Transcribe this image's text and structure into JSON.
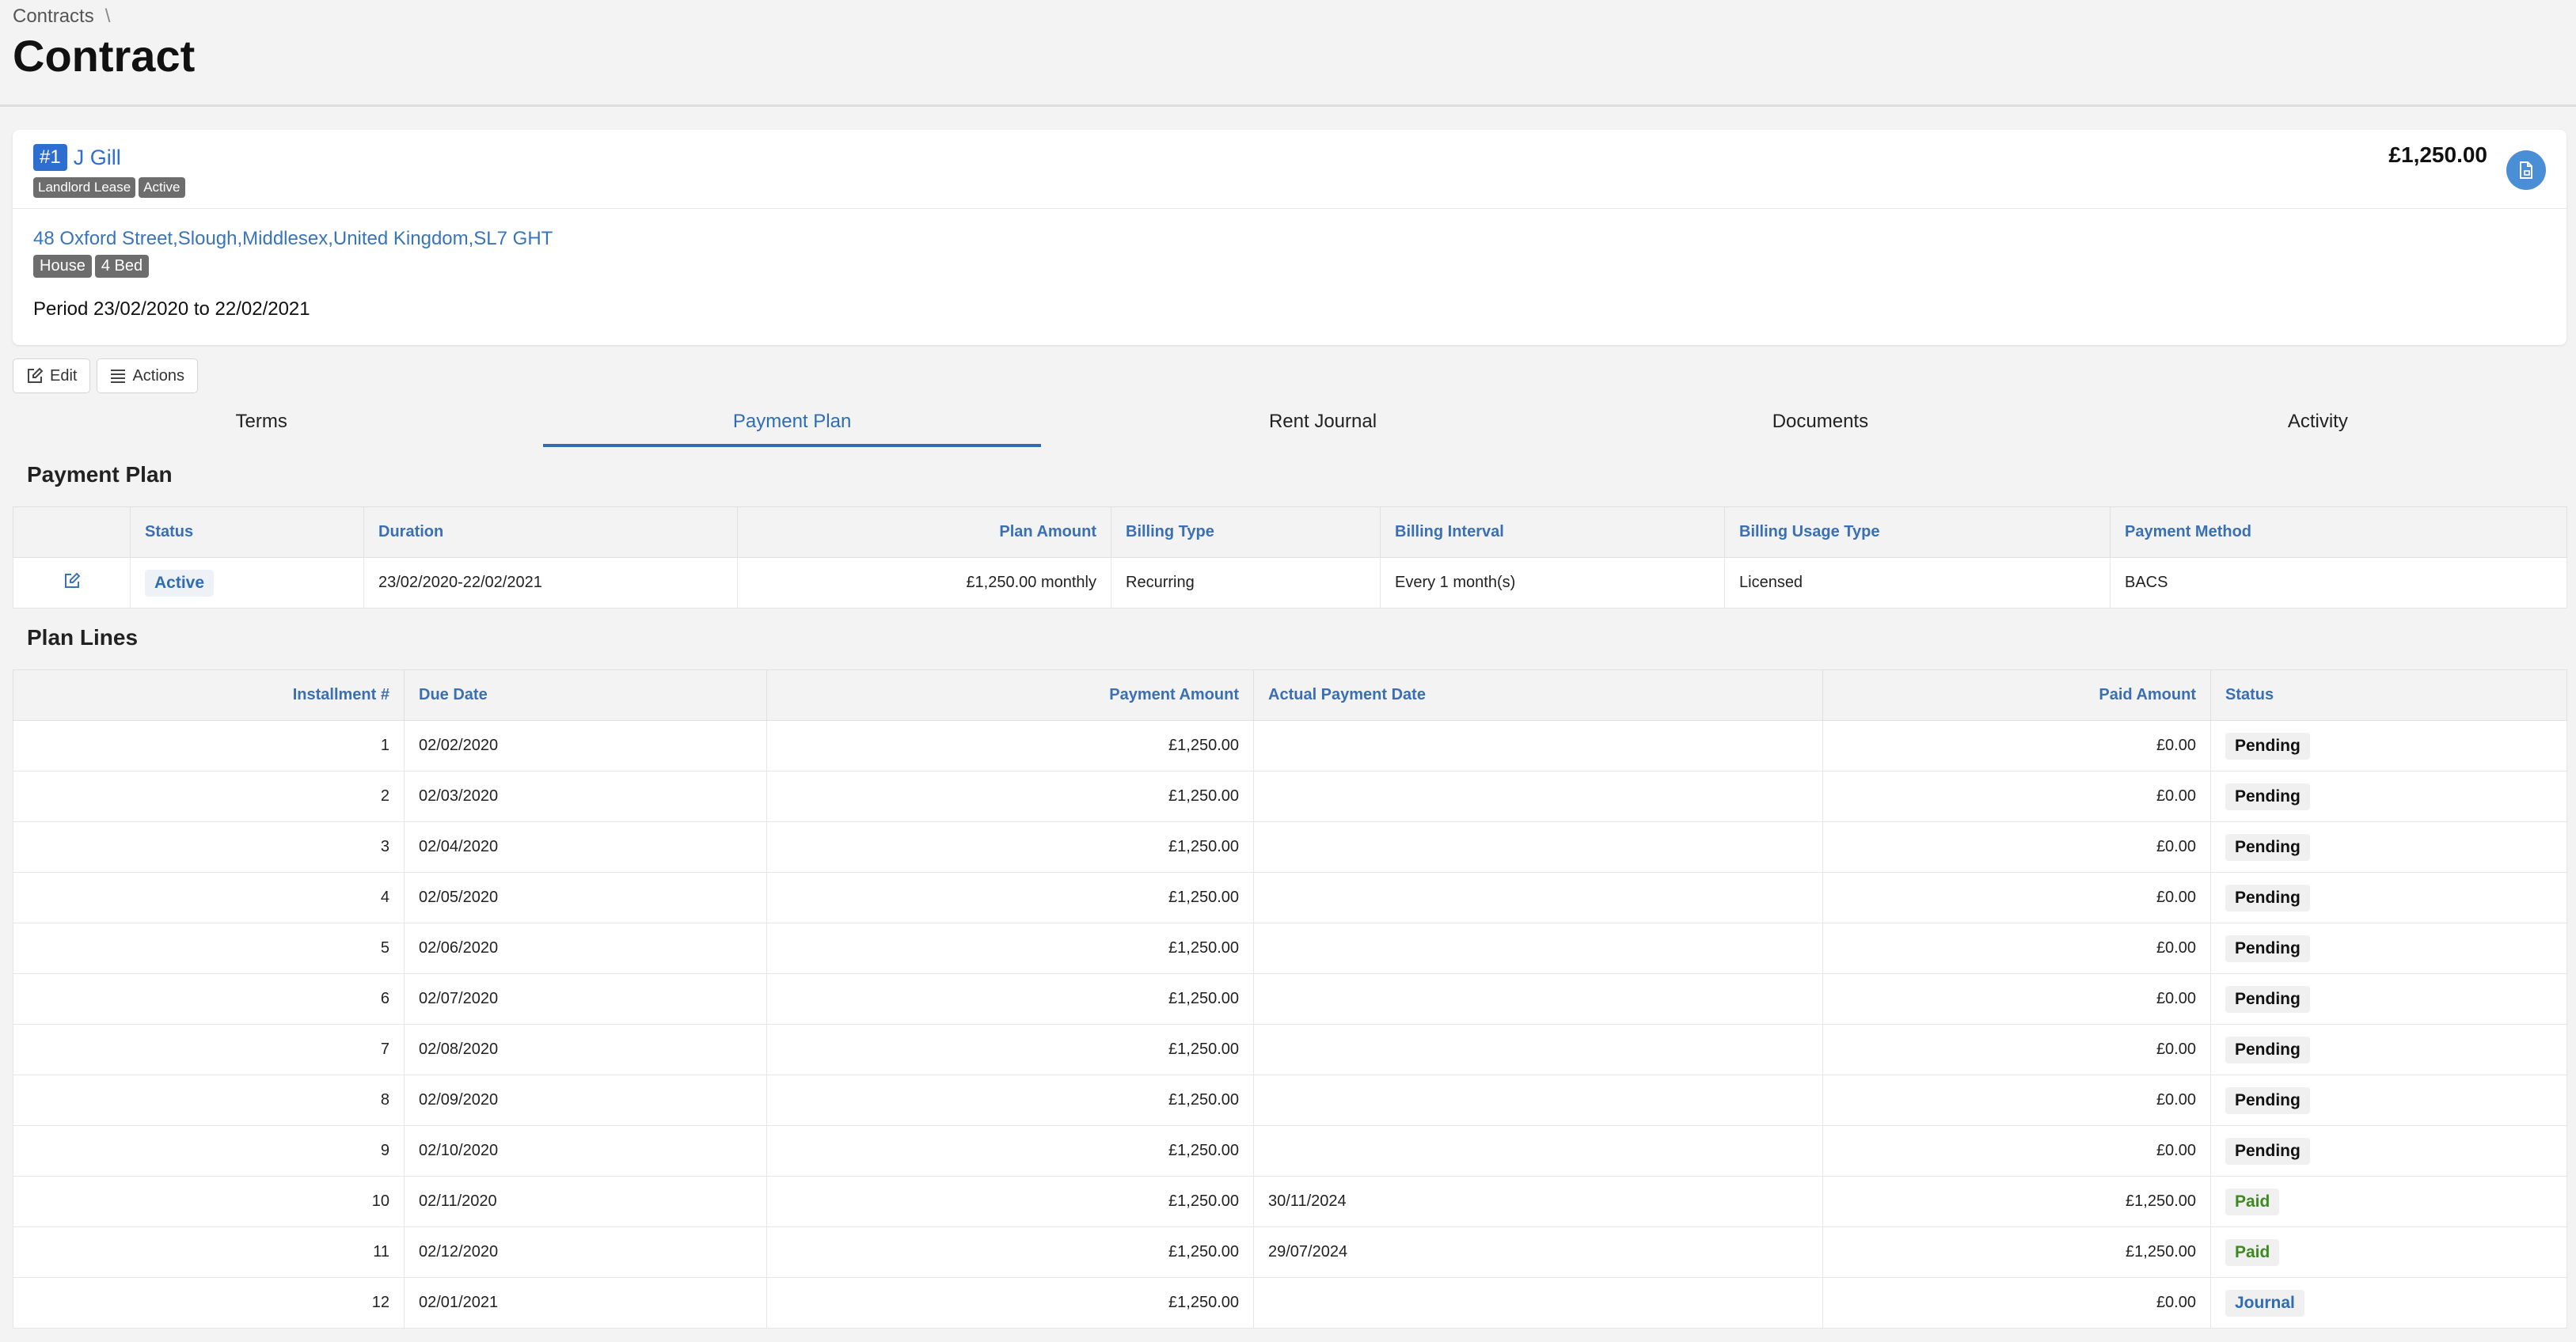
{
  "breadcrumb": {
    "parent": "Contracts",
    "separator": "\\"
  },
  "page_title": "Contract",
  "contract": {
    "id_badge": "#1",
    "name": "J Gill",
    "tags": [
      "Landlord Lease",
      "Active"
    ],
    "amount": "£1,250.00",
    "address": "48 Oxford Street,Slough,Middlesex,United Kingdom,SL7 GHT",
    "property_tags": [
      "House",
      "4 Bed"
    ],
    "period": "Period 23/02/2020 to 22/02/2021"
  },
  "toolbar": {
    "edit_label": "Edit",
    "actions_label": "Actions"
  },
  "tabs": [
    {
      "label": "Terms",
      "active": false
    },
    {
      "label": "Payment Plan",
      "active": true
    },
    {
      "label": "Rent Journal",
      "active": false
    },
    {
      "label": "Documents",
      "active": false
    },
    {
      "label": "Activity",
      "active": false
    }
  ],
  "payment_plan": {
    "title": "Payment Plan",
    "headers": {
      "status": "Status",
      "duration": "Duration",
      "plan_amount": "Plan Amount",
      "billing_type": "Billing Type",
      "billing_interval": "Billing Interval",
      "billing_usage_type": "Billing Usage Type",
      "payment_method": "Payment Method"
    },
    "row": {
      "status": "Active",
      "duration": "23/02/2020-22/02/2021",
      "plan_amount": "£1,250.00 monthly",
      "billing_type": "Recurring",
      "billing_interval": "Every 1 month(s)",
      "billing_usage_type": "Licensed",
      "payment_method": "BACS"
    }
  },
  "plan_lines": {
    "title": "Plan Lines",
    "headers": {
      "installment": "Installment #",
      "due_date": "Due Date",
      "payment_amount": "Payment Amount",
      "actual_payment_date": "Actual Payment Date",
      "paid_amount": "Paid Amount",
      "status": "Status"
    },
    "rows": [
      {
        "installment": "1",
        "due_date": "02/02/2020",
        "payment_amount": "£1,250.00",
        "actual_payment_date": "",
        "paid_amount": "£0.00",
        "status": "Pending"
      },
      {
        "installment": "2",
        "due_date": "02/03/2020",
        "payment_amount": "£1,250.00",
        "actual_payment_date": "",
        "paid_amount": "£0.00",
        "status": "Pending"
      },
      {
        "installment": "3",
        "due_date": "02/04/2020",
        "payment_amount": "£1,250.00",
        "actual_payment_date": "",
        "paid_amount": "£0.00",
        "status": "Pending"
      },
      {
        "installment": "4",
        "due_date": "02/05/2020",
        "payment_amount": "£1,250.00",
        "actual_payment_date": "",
        "paid_amount": "£0.00",
        "status": "Pending"
      },
      {
        "installment": "5",
        "due_date": "02/06/2020",
        "payment_amount": "£1,250.00",
        "actual_payment_date": "",
        "paid_amount": "£0.00",
        "status": "Pending"
      },
      {
        "installment": "6",
        "due_date": "02/07/2020",
        "payment_amount": "£1,250.00",
        "actual_payment_date": "",
        "paid_amount": "£0.00",
        "status": "Pending"
      },
      {
        "installment": "7",
        "due_date": "02/08/2020",
        "payment_amount": "£1,250.00",
        "actual_payment_date": "",
        "paid_amount": "£0.00",
        "status": "Pending"
      },
      {
        "installment": "8",
        "due_date": "02/09/2020",
        "payment_amount": "£1,250.00",
        "actual_payment_date": "",
        "paid_amount": "£0.00",
        "status": "Pending"
      },
      {
        "installment": "9",
        "due_date": "02/10/2020",
        "payment_amount": "£1,250.00",
        "actual_payment_date": "",
        "paid_amount": "£0.00",
        "status": "Pending"
      },
      {
        "installment": "10",
        "due_date": "02/11/2020",
        "payment_amount": "£1,250.00",
        "actual_payment_date": "30/11/2024",
        "paid_amount": "£1,250.00",
        "status": "Paid"
      },
      {
        "installment": "11",
        "due_date": "02/12/2020",
        "payment_amount": "£1,250.00",
        "actual_payment_date": "29/07/2024",
        "paid_amount": "£1,250.00",
        "status": "Paid"
      },
      {
        "installment": "12",
        "due_date": "02/01/2021",
        "payment_amount": "£1,250.00",
        "actual_payment_date": "",
        "paid_amount": "£0.00",
        "status": "Journal"
      }
    ]
  },
  "icons": {
    "document": "document-icon",
    "edit": "pencil-square-icon",
    "actions": "list-icon",
    "row_edit": "pencil-square-icon"
  },
  "colors": {
    "accent": "#2e6db4",
    "badge_blue": "#2c6fd1",
    "tag_gray": "#6d6d6d",
    "paid_green": "#3d8b1f"
  }
}
